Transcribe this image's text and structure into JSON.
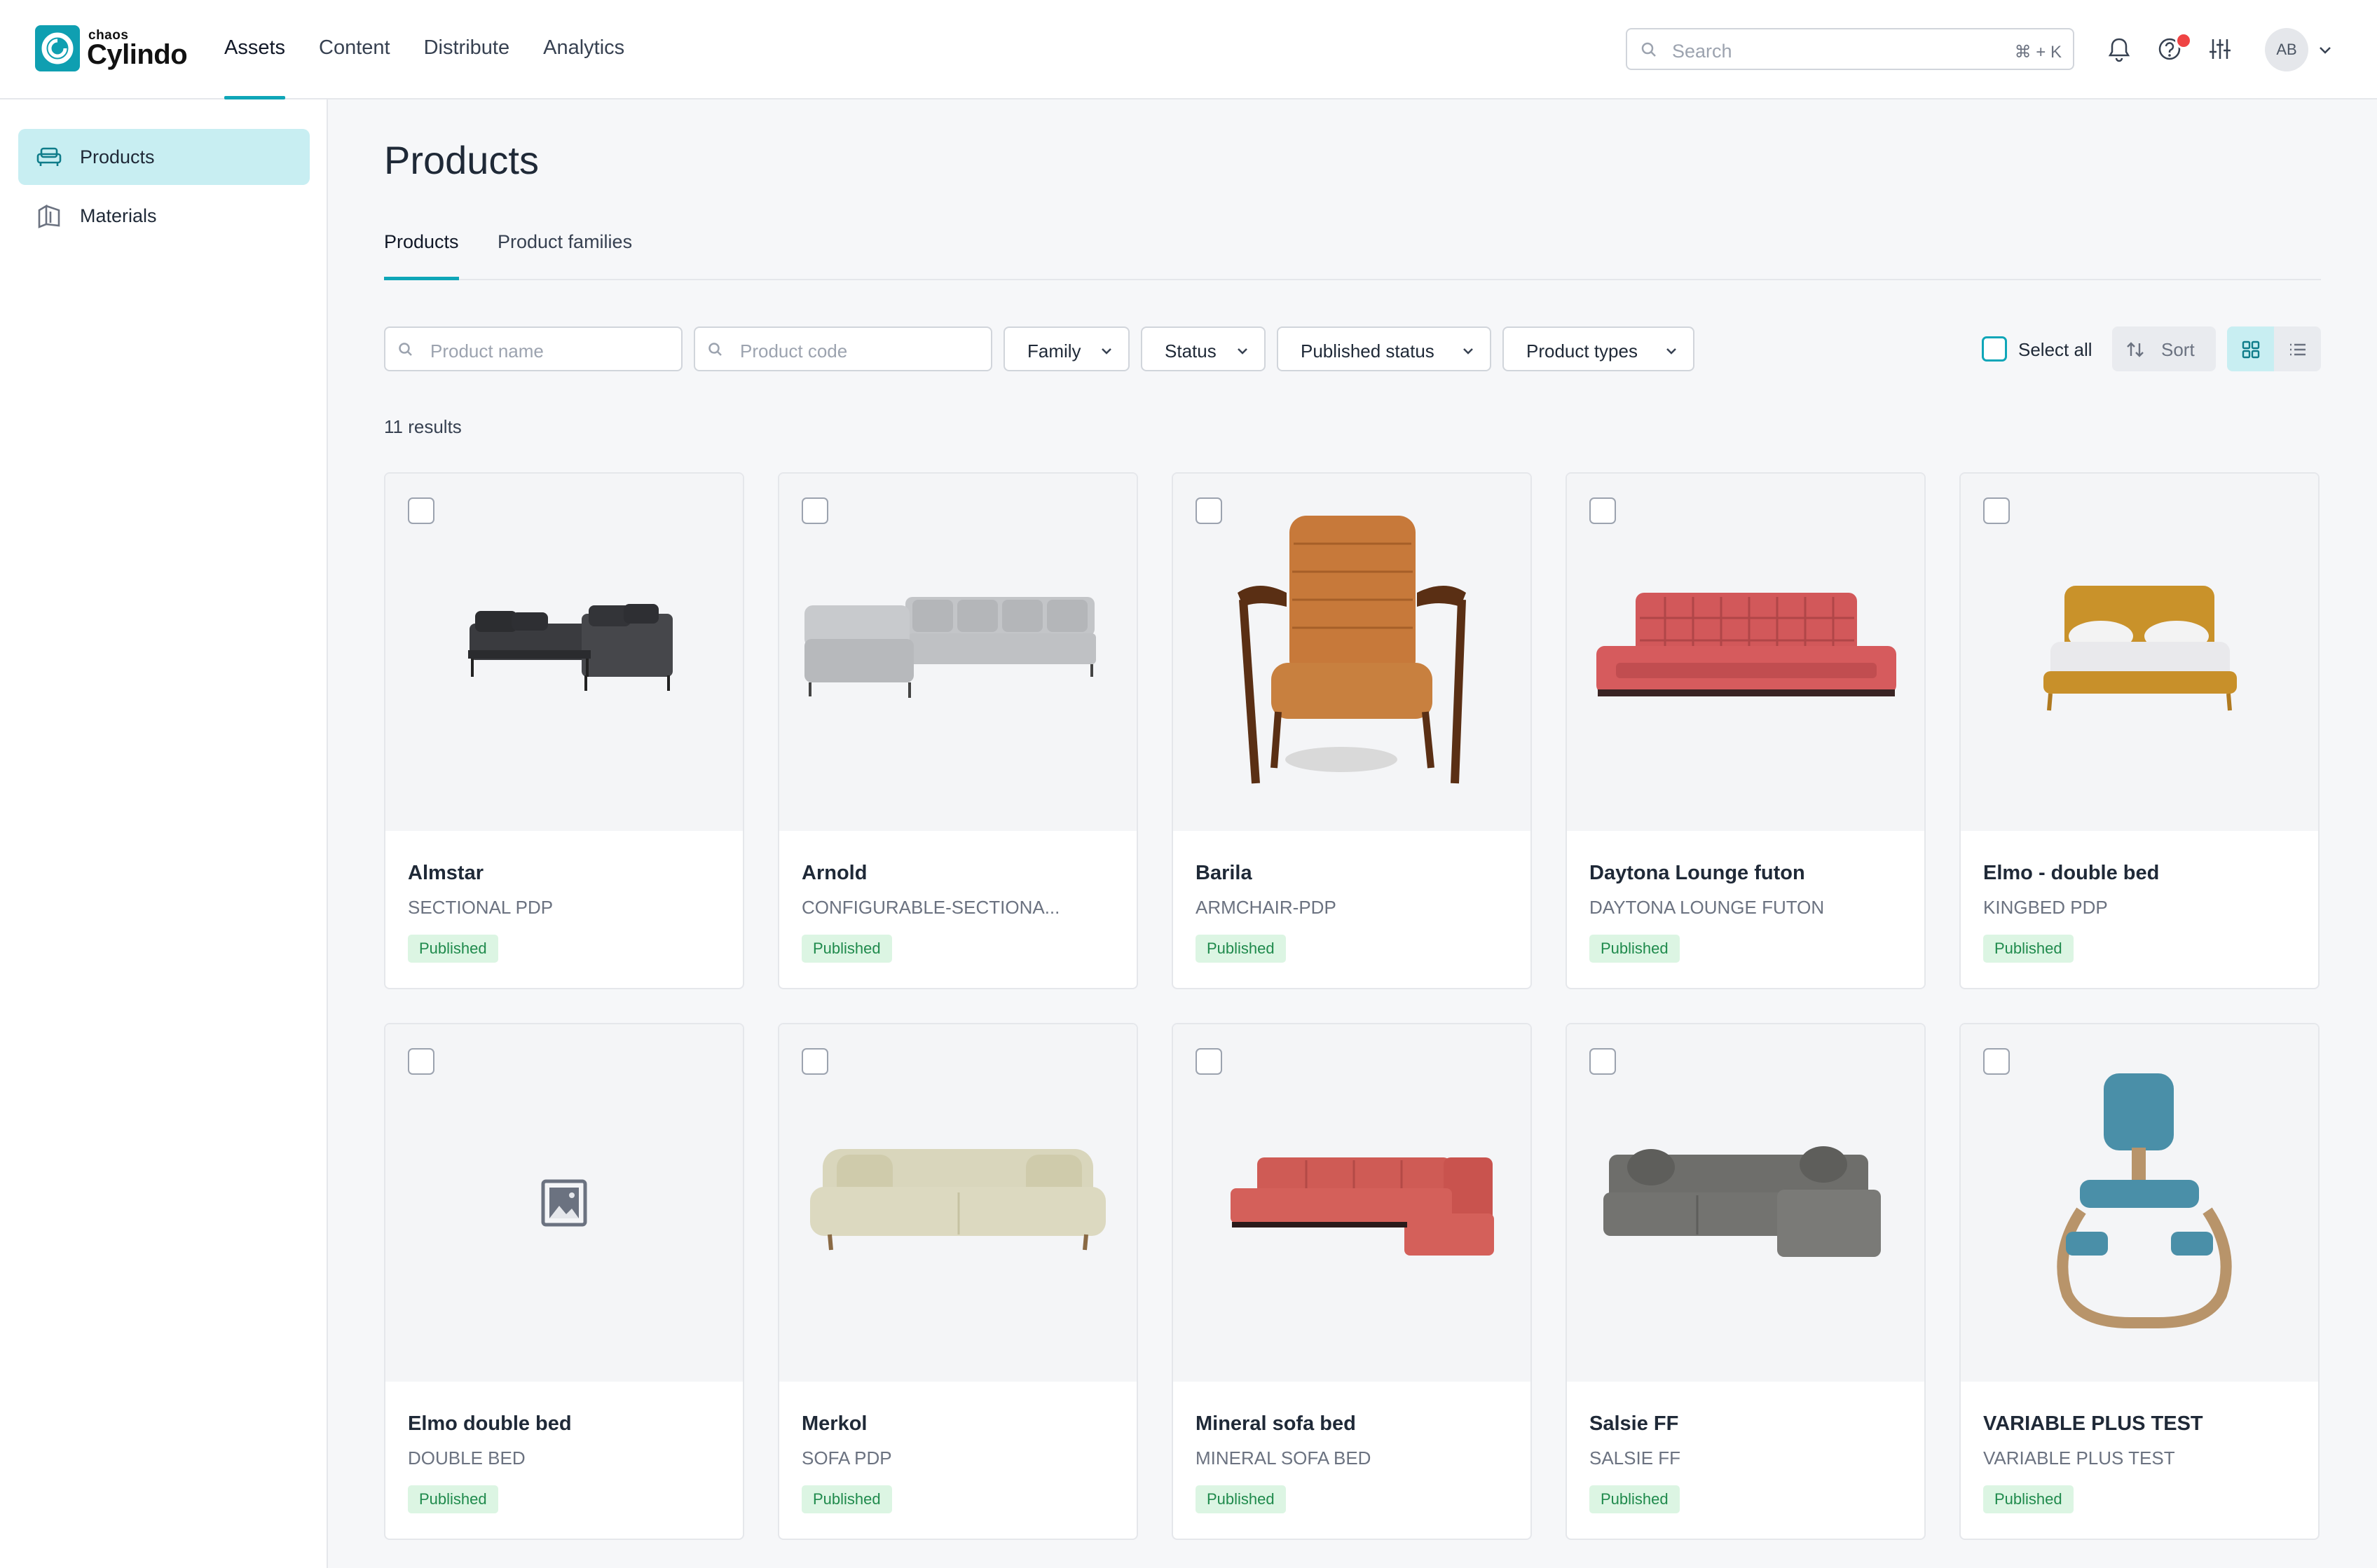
{
  "app": {
    "brand_small": "chaos",
    "brand_name": "Cylindo"
  },
  "topnav": [
    {
      "label": "Assets",
      "active": true
    },
    {
      "label": "Content"
    },
    {
      "label": "Distribute"
    },
    {
      "label": "Analytics"
    }
  ],
  "search": {
    "placeholder": "Search",
    "shortcut": "⌘ + K"
  },
  "user": {
    "initials": "AB"
  },
  "sidebar": {
    "items": [
      {
        "label": "Products",
        "icon": "sofa-icon",
        "active": true
      },
      {
        "label": "Materials",
        "icon": "materials-icon"
      }
    ]
  },
  "page": {
    "title": "Products"
  },
  "tabs": [
    {
      "label": "Products",
      "active": true
    },
    {
      "label": "Product families"
    }
  ],
  "filters": {
    "product_name_placeholder": "Product name",
    "product_code_placeholder": "Product code",
    "family": "Family",
    "status": "Status",
    "published_status": "Published status",
    "product_types": "Product types"
  },
  "toolbar": {
    "select_all": "Select all",
    "sort": "Sort",
    "view_mode": "grid"
  },
  "results": {
    "count_label": "11 results"
  },
  "colors": {
    "accent": "#0fa6b8",
    "accent_light": "#c8eef2",
    "badge_bg": "#dcf5e3",
    "badge_text": "#1f8a4c"
  },
  "products": [
    {
      "name": "Almstar",
      "code": "SECTIONAL PDP",
      "status": "Published",
      "image": "dark-sectional-sofa"
    },
    {
      "name": "Arnold",
      "code": "CONFIGURABLE-SECTIONA...",
      "status": "Published",
      "image": "grey-sectional-sofa"
    },
    {
      "name": "Barila",
      "code": "ARMCHAIR-PDP",
      "status": "Published",
      "image": "leather-armchair"
    },
    {
      "name": "Daytona Lounge futon",
      "code": "DAYTONA LOUNGE FUTON",
      "status": "Published",
      "image": "red-futon"
    },
    {
      "name": "Elmo - double bed",
      "code": "KINGBED PDP",
      "status": "Published",
      "image": "mustard-bed"
    },
    {
      "name": "Elmo double bed",
      "code": "DOUBLE BED",
      "status": "Published",
      "image": "image-placeholder-icon"
    },
    {
      "name": "Merkol",
      "code": "SOFA PDP",
      "status": "Published",
      "image": "beige-sofa"
    },
    {
      "name": "Mineral sofa bed",
      "code": "MINERAL SOFA BED",
      "status": "Published",
      "image": "red-sectional-sofa"
    },
    {
      "name": "Salsie FF",
      "code": "SALSIE FF",
      "status": "Published",
      "image": "grey-corner-sofa"
    },
    {
      "name": "VARIABLE PLUS TEST",
      "code": "VARIABLE PLUS TEST",
      "status": "Published",
      "image": "kneeling-chair"
    }
  ]
}
